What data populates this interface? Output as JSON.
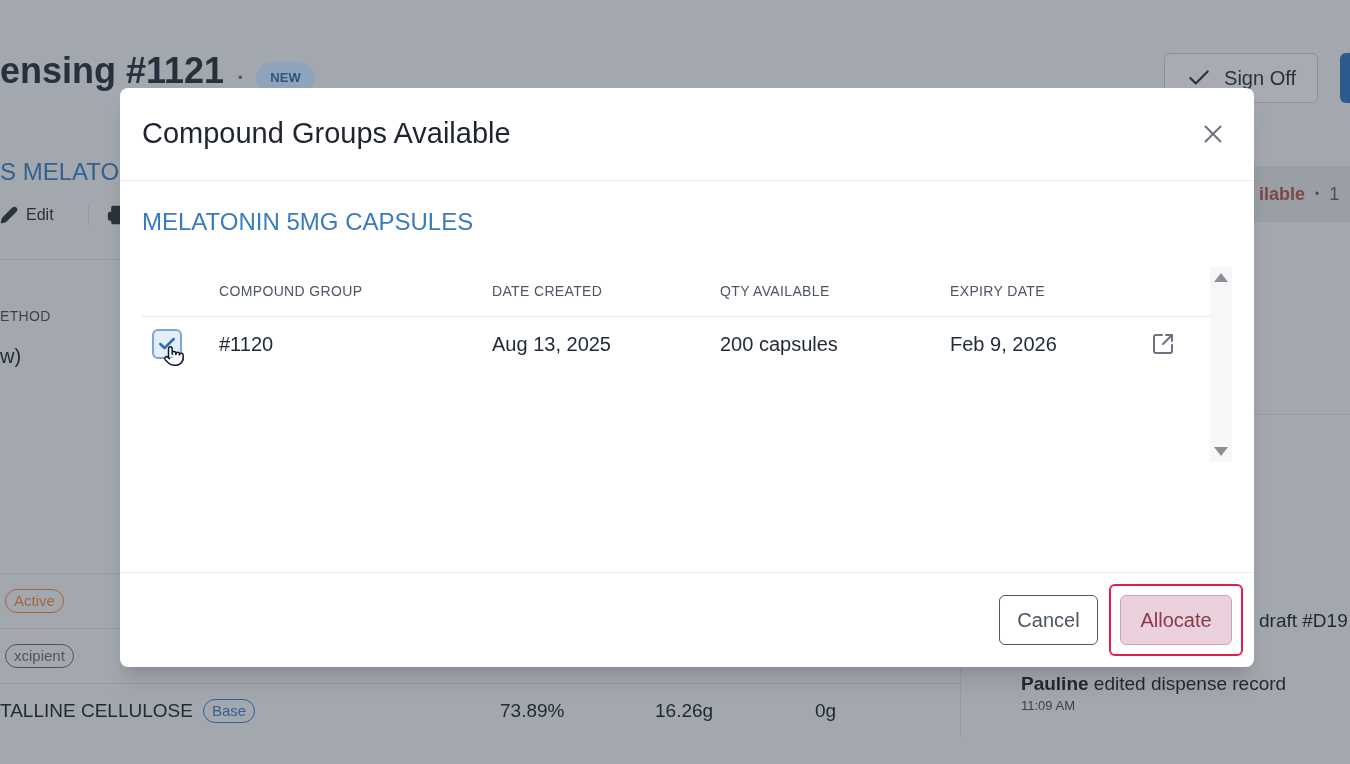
{
  "page": {
    "title": "ensing #1121",
    "separator": "•",
    "status_badge": "NEW",
    "sign_off": "Sign Off",
    "subtitle": "S MELATO",
    "toolbar": [
      {
        "kind": "edit",
        "label": "Edit"
      },
      {
        "kind": "print"
      }
    ],
    "method_label": "ETHOD",
    "method_value": "w)",
    "summary": {
      "text": "ilable",
      "separator": "•",
      "count": "1"
    },
    "ingredients": [
      {
        "badge": "Active",
        "color": "#a8643f"
      },
      {
        "badge": "xcipient",
        "color": "#50555e"
      },
      {
        "name": "TALLINE CELLULOSE",
        "badge": "Base",
        "color": "#355f8f",
        "percent": "73.89%",
        "weight": "16.26g",
        "allocated": "0g"
      }
    ],
    "activity": [
      {
        "text": "draft #D19"
      },
      {
        "text": "**Pauline** edited dispense record",
        "time": "11:09 AM"
      }
    ]
  },
  "dialog": {
    "title": "Compound Groups Available",
    "product": "MELATONIN 5MG CAPSULES",
    "columns": [
      "COMPOUND GROUP",
      "DATE CREATED",
      "QTY AVAILABLE",
      "EXPIRY DATE"
    ],
    "rows": [
      {
        "selected": true,
        "cells": [
          "#1120",
          "Aug 13, 2025",
          "200 capsules",
          "Feb 9, 2026"
        ]
      }
    ],
    "buttons": [
      {
        "label": "Cancel",
        "kind": "secondary",
        "focused": false
      },
      {
        "label": "Allocate",
        "kind": "primary",
        "focused": true
      }
    ]
  }
}
